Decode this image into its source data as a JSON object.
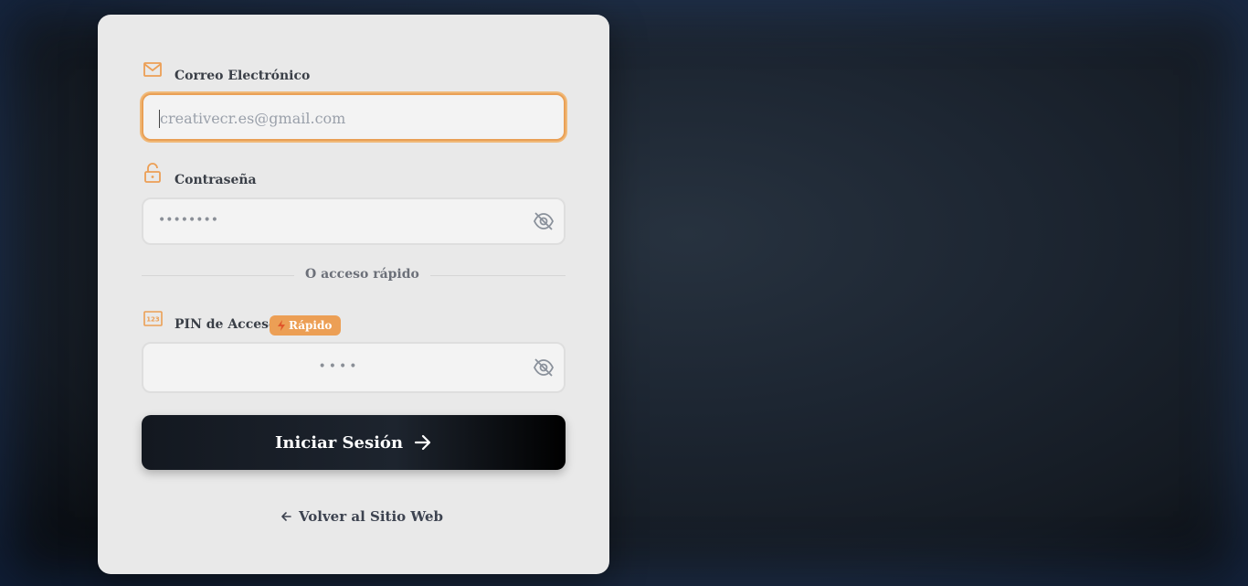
{
  "form": {
    "email": {
      "label": "Correo Electrónico",
      "placeholder": "creativecr.es@gmail.com",
      "icon": "mail-icon"
    },
    "password": {
      "label": "Contraseña",
      "masked_value": "••••••••",
      "icon": "lock-icon"
    },
    "divider_text": "O acceso rápido",
    "pin": {
      "label": "PIN de Acceso",
      "badge": "Rápido",
      "masked_value": "••••",
      "icon": "pin-123-icon"
    },
    "submit_label": "Iniciar Sesión",
    "back_label": "Volver al Sitio Web"
  },
  "colors": {
    "accent": "#ec9f55",
    "button_dark": "#131820",
    "card_bg": "#e9e9e9"
  }
}
